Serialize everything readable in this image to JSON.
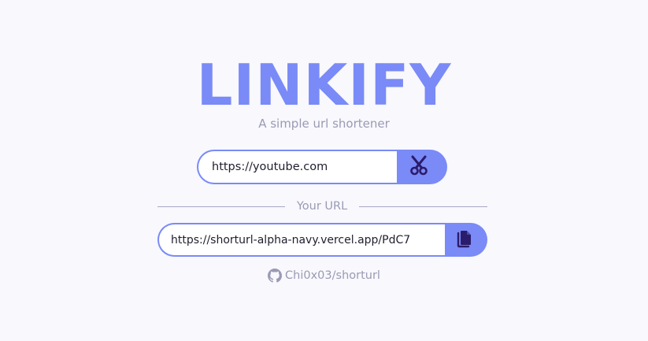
{
  "app": {
    "title": "LINKIFY",
    "tagline": "A simple url shortener"
  },
  "shortener": {
    "input_value": "https://youtube.com",
    "button_icon": "scissors-icon"
  },
  "result": {
    "divider_label": "Your URL",
    "short_url": "https://shorturl-alpha-navy.vercel.app/PdC7",
    "copy_icon": "copy-icon"
  },
  "footer": {
    "repo_icon": "github-icon",
    "repo_label": "Chi0x03/shorturl"
  },
  "colors": {
    "accent": "#7a8af7",
    "icon_dark": "#2b1c6b",
    "muted_text": "#9a9ab4",
    "background": "#f8f8fd"
  }
}
